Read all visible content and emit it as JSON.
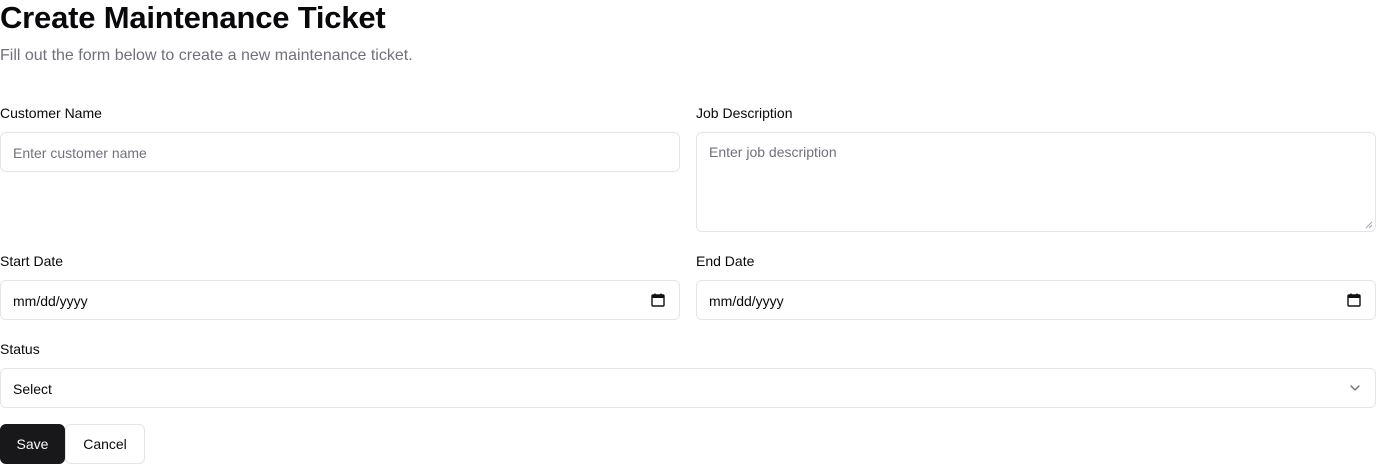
{
  "header": {
    "title": "Create Maintenance Ticket",
    "subtitle": "Fill out the form below to create a new maintenance ticket."
  },
  "form": {
    "customer_name": {
      "label": "Customer Name",
      "value": "",
      "placeholder": "Enter customer name"
    },
    "job_description": {
      "label": "Job Description",
      "value": "",
      "placeholder": "Enter job description"
    },
    "start_date": {
      "label": "Start Date",
      "display": "mm/dd/yyyy",
      "icon": "calendar-icon"
    },
    "end_date": {
      "label": "End Date",
      "display": "mm/dd/yyyy",
      "icon": "calendar-icon"
    },
    "status": {
      "label": "Status",
      "selected": "Select",
      "icon": "chevron-down-icon"
    }
  },
  "actions": {
    "save_label": "Save",
    "cancel_label": "Cancel"
  },
  "colors": {
    "primary": "#18181b",
    "border": "#e4e4e7",
    "muted_text": "#71717a"
  }
}
